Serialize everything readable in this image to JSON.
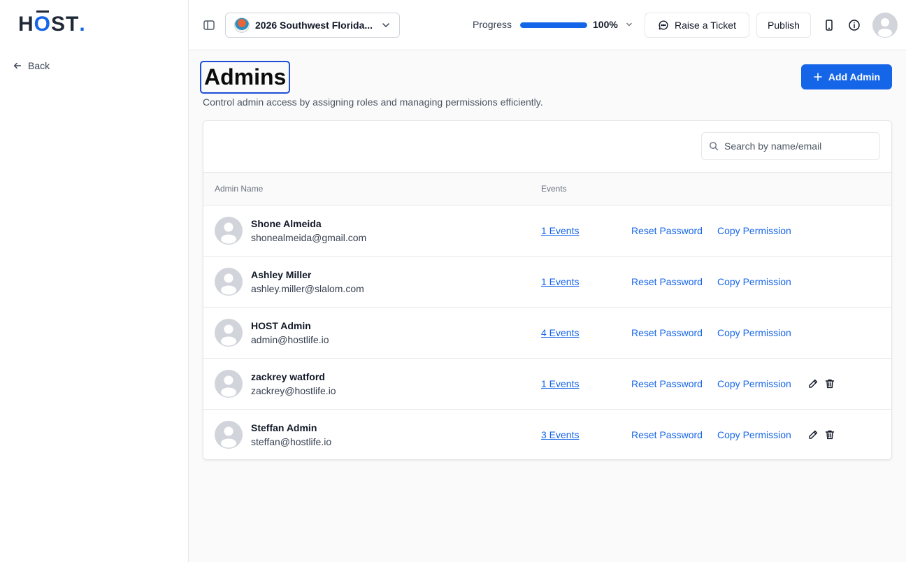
{
  "brand": {
    "logo_h": "H",
    "logo_o": "O",
    "logo_st": "ST",
    "logo_dot": ".",
    "accent": "#1565e8"
  },
  "sidebar": {
    "back_label": "Back",
    "back_icon": "arrow-left-icon"
  },
  "topbar": {
    "event_name": "2026 Southwest Florida...",
    "progress_label": "Progress",
    "progress_value": "100%",
    "progress_fraction": 1.0,
    "ticket_label": "Raise a Ticket",
    "publish_label": "Publish",
    "icons": [
      "panel-toggle-icon",
      "chevron-down-icon",
      "chat-bubble-icon",
      "mobile-icon",
      "info-icon",
      "user-avatar-icon"
    ]
  },
  "main": {
    "title": "Admins",
    "subtitle": "Control admin access by assigning roles and managing permissions efficiently.",
    "add_button": "Add Admin",
    "search_placeholder": "Search by name/email",
    "columns": {
      "name": "Admin Name",
      "events": "Events"
    },
    "reset_label": "Reset Password",
    "copy_label": "Copy Permission",
    "admins": [
      {
        "name": "Shone Almeida",
        "email": "shonealmeida@gmail.com",
        "events": "1 Events",
        "editable": false
      },
      {
        "name": "Ashley Miller",
        "email": "ashley.miller@slalom.com",
        "events": "1 Events",
        "editable": false
      },
      {
        "name": "HOST Admin",
        "email": "admin@hostlife.io",
        "events": "4 Events",
        "editable": false
      },
      {
        "name": "zackrey watford",
        "email": "zackrey@hostlife.io",
        "events": "1 Events",
        "editable": true
      },
      {
        "name": "Steffan Admin",
        "email": "steffan@hostlife.io",
        "events": "3 Events",
        "editable": true
      }
    ]
  }
}
